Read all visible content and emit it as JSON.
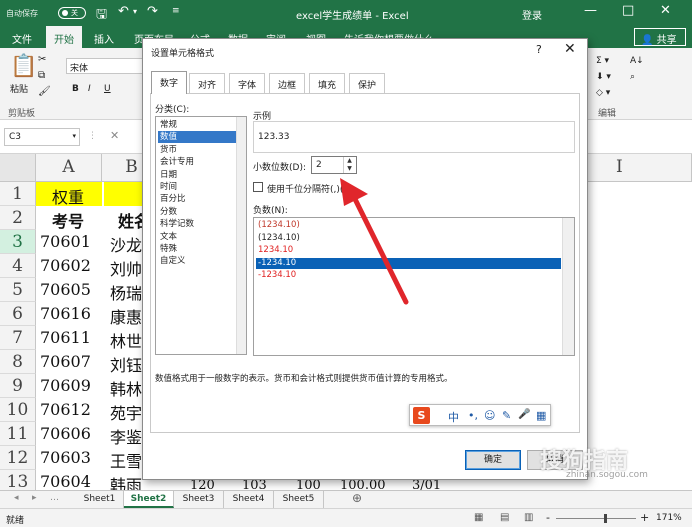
{
  "titlebar": {
    "autosave_label": "自动保存",
    "autosave_state": "关",
    "title": "excel学生成绩单 - Excel",
    "login": "登录",
    "controls": {
      "minimize": "—",
      "maximize": "□",
      "close": "✕"
    }
  },
  "ribbon_tabs": [
    "文件",
    "开始",
    "插入",
    "页面布局",
    "公式",
    "数据",
    "审阅",
    "视图"
  ],
  "ribbon_search": "告诉我你想要做什么",
  "share_label": "共享",
  "ribbon": {
    "paste": "粘贴",
    "clipboard_group": "剪贴板",
    "font_name": "宋体",
    "bold": "B",
    "italic": "I",
    "underline": "U",
    "editing_group": "编辑"
  },
  "formula_bar": {
    "namebox": "C3"
  },
  "columns": [
    "A",
    "B"
  ],
  "rows": [
    {
      "num": "1",
      "a": "权重",
      "b": ""
    },
    {
      "num": "2",
      "a": "考号",
      "b": "姓名"
    },
    {
      "num": "3",
      "a": "70601",
      "b": "沙龙"
    },
    {
      "num": "4",
      "a": "70602",
      "b": "刘帅"
    },
    {
      "num": "5",
      "a": "70605",
      "b": "杨瑞"
    },
    {
      "num": "6",
      "a": "70616",
      "b": "康惠"
    },
    {
      "num": "7",
      "a": "70611",
      "b": "林世"
    },
    {
      "num": "8",
      "a": "70607",
      "b": "刘钰"
    },
    {
      "num": "9",
      "a": "70609",
      "b": "韩林"
    },
    {
      "num": "10",
      "a": "70612",
      "b": "苑宇"
    },
    {
      "num": "11",
      "a": "70606",
      "b": "李鉴"
    },
    {
      "num": "12",
      "a": "70603",
      "b": "王雪"
    },
    {
      "num": "13",
      "a": "70604",
      "b": "韩雨"
    }
  ],
  "row13_tail": [
    "120",
    "103",
    "100",
    "100.00",
    "3/01"
  ],
  "sheets": [
    "Sheet1",
    "Sheet2",
    "Sheet3",
    "Sheet4",
    "Sheet5"
  ],
  "active_sheet": "Sheet2",
  "status": {
    "ready": "就绪",
    "zoom": "171%",
    "zoom_minus": "-",
    "zoom_plus": "+"
  },
  "dialog": {
    "title": "设置单元格格式",
    "help": "?",
    "close": "✕",
    "tabs": [
      "数字",
      "对齐",
      "字体",
      "边框",
      "填充",
      "保护"
    ],
    "category_label": "分类(C):",
    "categories": [
      "常规",
      "数值",
      "货币",
      "会计专用",
      "日期",
      "时间",
      "百分比",
      "分数",
      "科学记数",
      "文本",
      "特殊",
      "自定义"
    ],
    "selected_category": "数值",
    "sample_label": "示例",
    "sample_value": "123.33",
    "decimals_label": "小数位数(D):",
    "decimals_value": "2",
    "thousands_label": "使用千位分隔符(,)(U)",
    "negative_label": "负数(N):",
    "negative_options": [
      {
        "text": "(1234.10)",
        "color": "#c0392b"
      },
      {
        "text": "(1234.10)",
        "color": "#222222"
      },
      {
        "text": "1234.10",
        "color": "#e02020"
      },
      {
        "text": "-1234.10",
        "color": "#ffffff"
      },
      {
        "text": "-1234.10",
        "color": "#e02020"
      }
    ],
    "description": "数值格式用于一般数字的表示。货币和会计格式则提供货币值计算的专用格式。",
    "ok": "确定",
    "cancel": "取消"
  },
  "ime": {
    "logo": "S",
    "items": [
      "中",
      "•,",
      "☺",
      "✎",
      "🎤",
      "▦"
    ]
  },
  "watermark": {
    "text": "搜狗指南",
    "url": "zhinan.sogou.com"
  },
  "colors": {
    "excel_green": "#217346",
    "selection_blue": "#0a61b6",
    "arrow_red": "#e0262b",
    "row1_fill": "#ffff00"
  }
}
